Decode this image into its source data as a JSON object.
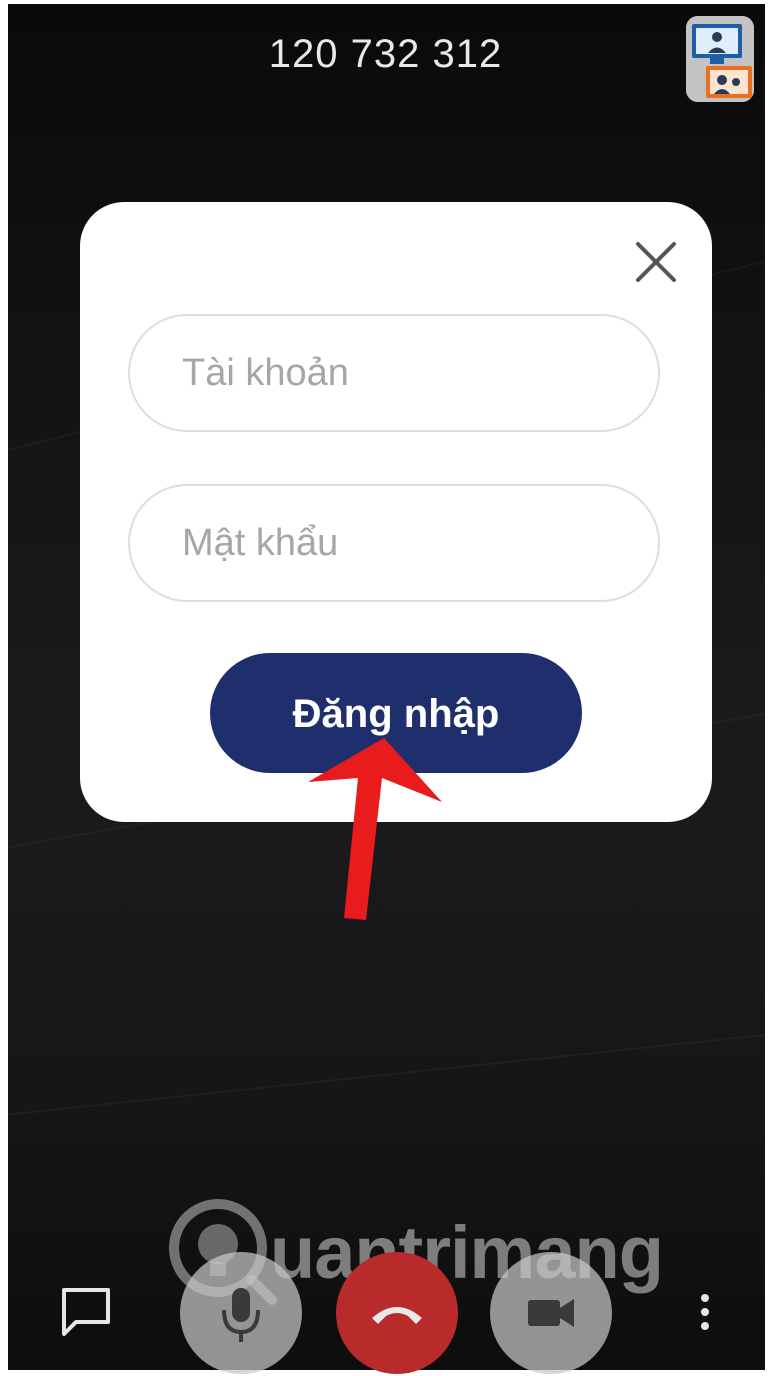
{
  "header": {
    "meeting_id": "120 732 312"
  },
  "login_dialog": {
    "account_placeholder": "Tài khoản",
    "password_placeholder": "Mật khẩu",
    "login_label": "Đăng nhập"
  },
  "watermark": {
    "text": "uantrimang"
  },
  "icons": {
    "close": "close-icon",
    "view_toggle": "gallery-view-icon",
    "chat": "chat-icon",
    "mic": "microphone-icon",
    "hangup": "phone-hangup-icon",
    "camera": "video-camera-icon",
    "more": "more-vertical-icon"
  },
  "colors": {
    "login_button": "#1f2f6e",
    "hangup_button": "#b92a2a",
    "annotation_arrow": "#e81c1c"
  }
}
